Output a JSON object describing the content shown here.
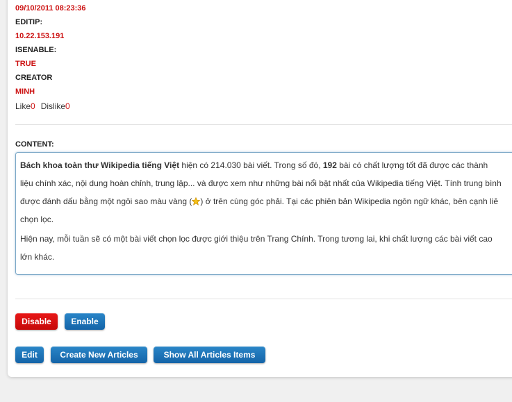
{
  "record": {
    "date_value": "09/10/2011 08:23:36",
    "editip_label": "EDITIP:",
    "editip_value": "10.22.153.191",
    "isenable_label": "ISENABLE:",
    "isenable_value": "TRUE",
    "creator_label": "CREATOR",
    "creator_value": "MINH"
  },
  "votes": {
    "like_label": "Like",
    "like_count": "0",
    "dislike_label": "Dislike",
    "dislike_count": "0"
  },
  "content": {
    "label": "CONTENT:",
    "p1_bold_a": "Bách khoa toàn thư Wikipedia tiếng Việt",
    "p1_text_a": " hiện có 214.030 bài viết. Trong số đó, ",
    "p1_bold_b": "192",
    "p1_text_b": " bài có chất lượng tốt đã được các thành",
    "p1_line2": "liệu chính xác, nội dung hoàn chỉnh, trung lập... và được xem như những bài nổi bật nhất của Wikipedia tiếng Việt. Tính trung bình",
    "p1_line3_a": "được đánh dấu bằng một ngôi sao màu vàng (",
    "p1_line3_b": ") ở trên cùng góc phải. Tại các phiên bản Wikipedia ngôn ngữ khác, bên cạnh liê",
    "p1_line4": "chọn lọc.",
    "p2_line1": "Hiện nay, mỗi tuần sẽ có một bài viết chọn lọc được giới thiệu trên Trang Chính. Trong tương lai, khi chất lượng các bài viết cao",
    "p2_line2": "lớn khác.",
    "star_icon": "star-icon"
  },
  "actions": {
    "disable_label": "Disable",
    "enable_label": "Enable",
    "edit_label": "Edit",
    "create_label": "Create New Articles",
    "show_all_label": "Show All Articles Items"
  },
  "colors": {
    "value_red": "#cc1111",
    "button_red": "#d81010",
    "button_blue": "#1e73b8",
    "content_border": "#7aa7c7"
  }
}
